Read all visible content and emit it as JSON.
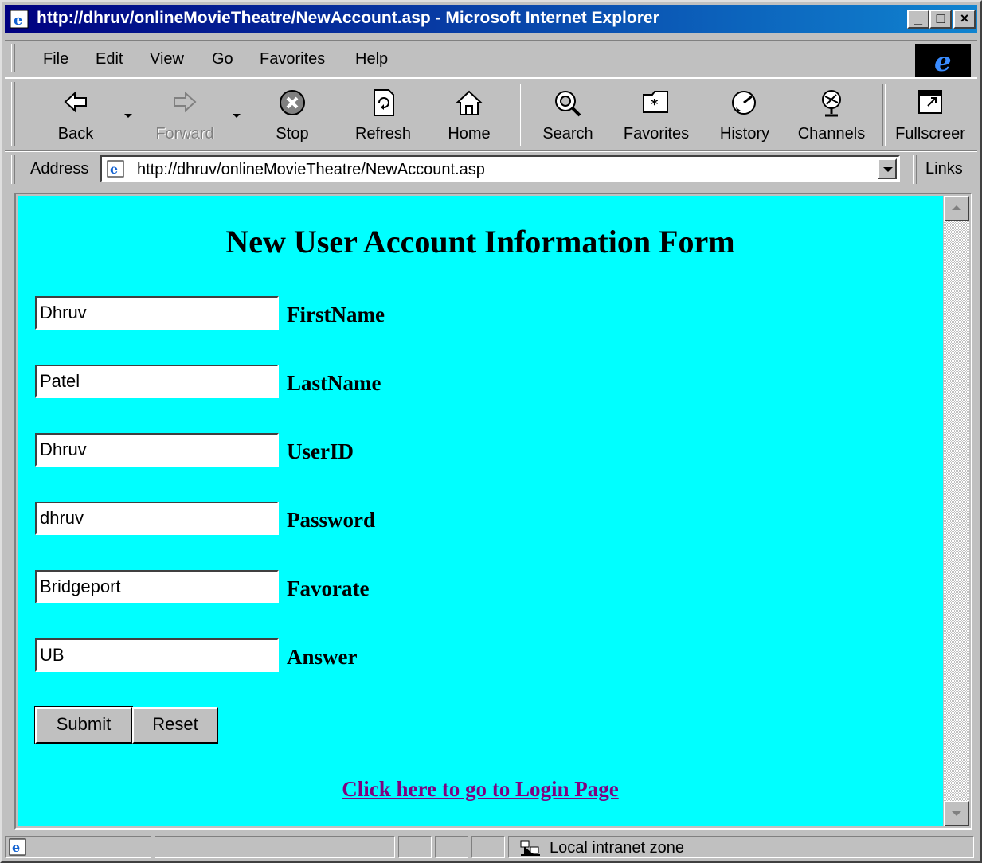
{
  "window": {
    "title": "http://dhruv/onlineMovieTheatre/NewAccount.asp - Microsoft Internet Explorer",
    "minimize": "_",
    "maximize": "□",
    "close": "×"
  },
  "menu": {
    "file": "File",
    "edit": "Edit",
    "view": "View",
    "go": "Go",
    "favorites": "Favorites",
    "help": "Help"
  },
  "toolbar": {
    "back": "Back",
    "forward": "Forward",
    "stop": "Stop",
    "refresh": "Refresh",
    "home": "Home",
    "search": "Search",
    "favorites": "Favorites",
    "history": "History",
    "channels": "Channels",
    "fullscreen": "Fullscreer"
  },
  "address": {
    "label": "Address",
    "url": "http://dhruv/onlineMovieTheatre/NewAccount.asp",
    "links": "Links"
  },
  "page": {
    "heading": "New User Account Information Form",
    "fields": [
      {
        "value": "Dhruv",
        "label": "FirstName"
      },
      {
        "value": "Patel",
        "label": "LastName"
      },
      {
        "value": "Dhruv",
        "label": "UserID"
      },
      {
        "value": "dhruv",
        "label": "Password"
      },
      {
        "value": "Bridgeport",
        "label": "Favorate"
      },
      {
        "value": "UB",
        "label": "Answer"
      }
    ],
    "submit": "Submit",
    "reset": "Reset",
    "login_link": "Click here to go to Login Page",
    "background": "#00ffff",
    "link_color": "#800080"
  },
  "status": {
    "zone": "Local intranet zone"
  }
}
